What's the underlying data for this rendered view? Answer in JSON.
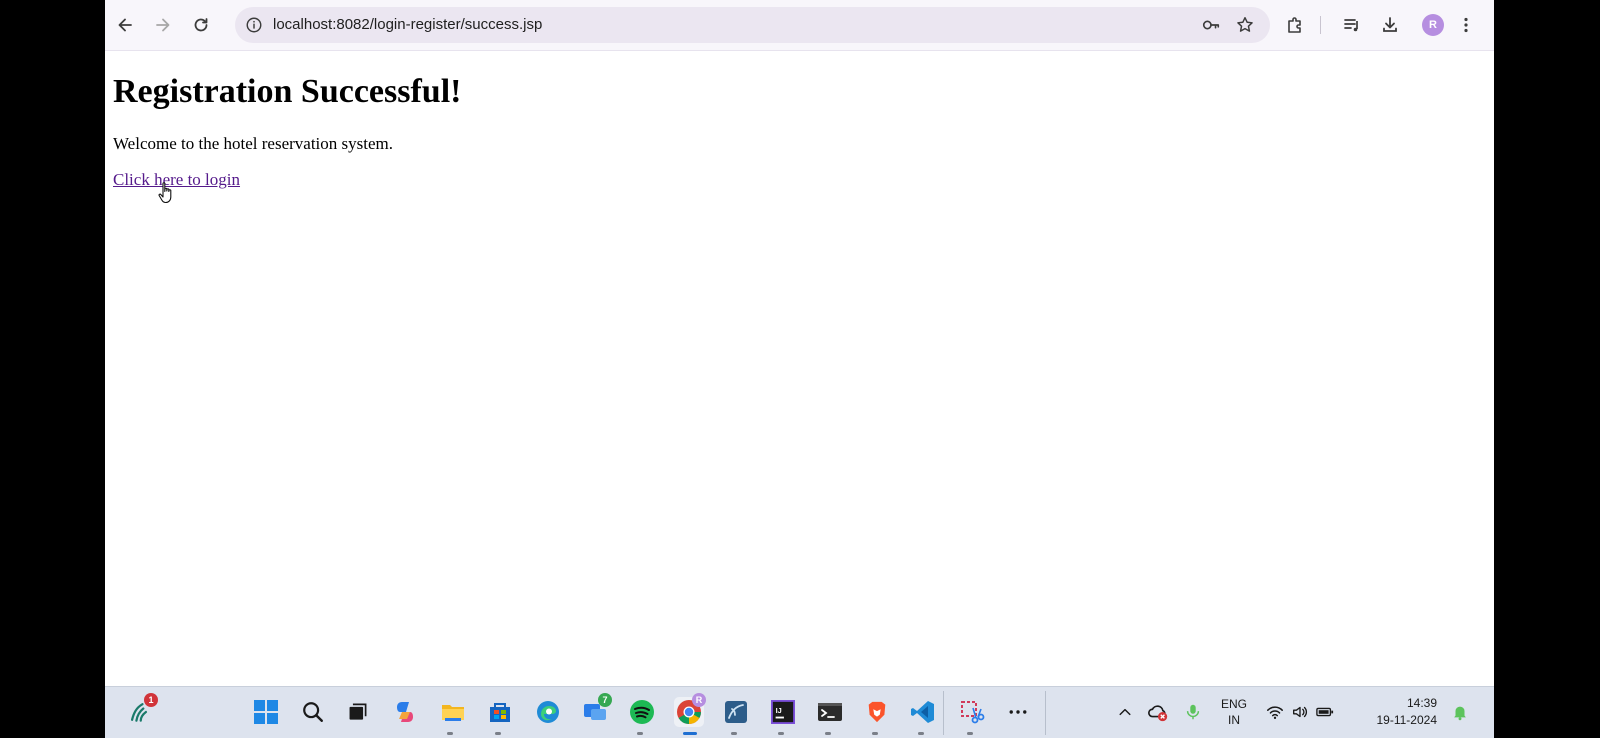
{
  "browser": {
    "url": "localhost:8082/login-register/success.jsp",
    "profile_initial": "R"
  },
  "page": {
    "heading": "Registration Successful!",
    "message": "Welcome to the hotel reservation system.",
    "login_link": "Click here to login"
  },
  "taskbar": {
    "widget_badge": "1",
    "teams_badge": "7",
    "tray": {
      "language": "ENG",
      "region": "IN",
      "time": "14:39",
      "date": "19-11-2024"
    }
  },
  "colors": {
    "link_visited": "#551a8b",
    "omnibox": "#ebe6f1",
    "taskbar": "#dde3ee"
  }
}
